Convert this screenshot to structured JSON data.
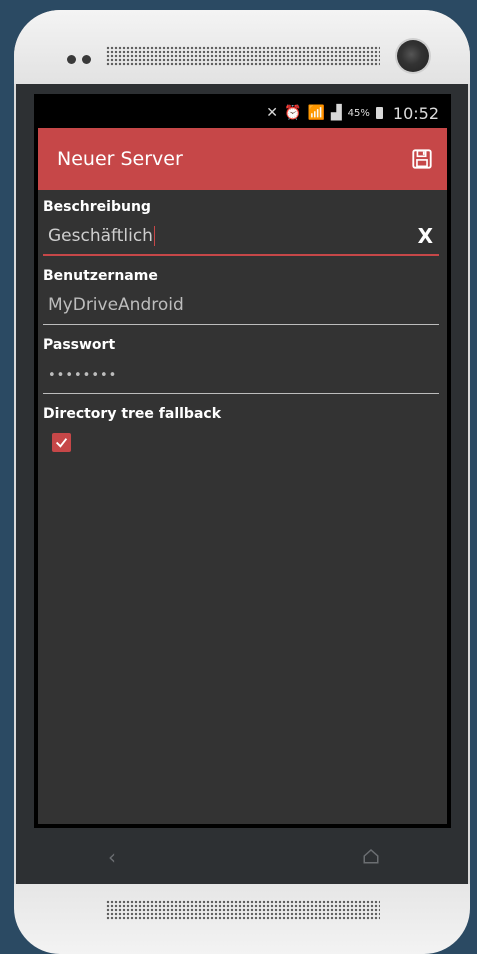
{
  "status_bar": {
    "icons": [
      "mute-icon",
      "alarm-icon",
      "wifi-icon",
      "signal-icon"
    ],
    "battery_percent": "45%",
    "time": "10:52"
  },
  "app_bar": {
    "title": "Neuer Server",
    "save_icon": "save-icon",
    "background_color": "#c64748"
  },
  "form": {
    "description": {
      "label": "Beschreibung",
      "value": "Geschäftlich",
      "clear_label": "X"
    },
    "username": {
      "label": "Benutzername",
      "value": "MyDriveAndroid"
    },
    "password": {
      "label": "Passwort",
      "value": "••••••••"
    },
    "directory_tree_fallback": {
      "label": "Directory tree fallback",
      "checked": true
    }
  },
  "nav": {
    "back_icon": "back-icon",
    "home_icon": "home-icon"
  }
}
